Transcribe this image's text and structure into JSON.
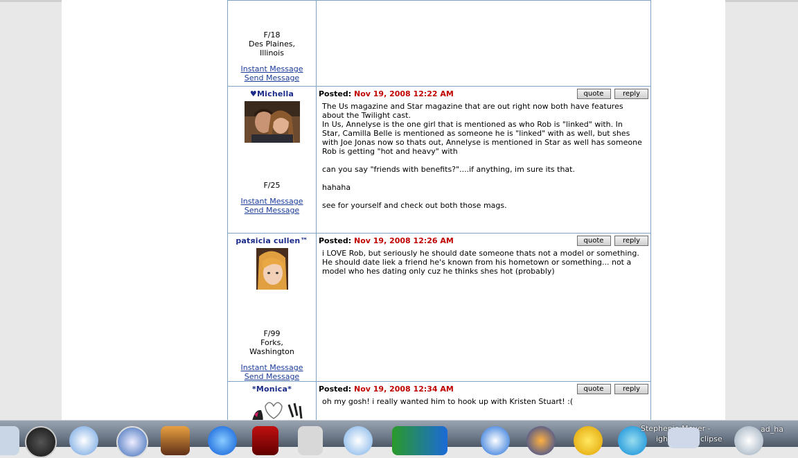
{
  "posts": [
    {
      "username": "",
      "has_avatar": false,
      "meta": [
        "F/18",
        "Des Plaines,",
        "Illinois"
      ],
      "links": [
        "Instant Message",
        "Send Message"
      ],
      "posted_label": "",
      "date": "",
      "buttons": [],
      "body": ""
    },
    {
      "username": "♥Michella",
      "has_avatar": true,
      "meta": [
        "F/25"
      ],
      "links": [
        "Instant Message",
        "Send Message"
      ],
      "posted_label": "Posted:",
      "date": "Nov 19, 2008 12:22 AM",
      "buttons": [
        "quote",
        "reply"
      ],
      "body": "The Us magazine and Star magazine that are out right now both have features about the Twilight cast.\nIn Us, Annelyse is the one girl that is mentioned as who Rob is \"linked\" with. In Star, Camilla Belle is mentioned as someone he is \"linked\" with as well, but shes with Joe Jonas now so thats out, Annelyse is mentioned in Star as well has someone Rob is getting \"hot and heavy\" with\n\ncan you say \"friends with benefits?\"....if anything, im sure its that.\n\nhahaha\n\nsee for yourself and check out both those mags."
    },
    {
      "username": "patяicia cullen™",
      "has_avatar": true,
      "meta": [
        "F/99",
        "Forks,",
        "Washington"
      ],
      "links": [
        "Instant Message",
        "Send Message"
      ],
      "posted_label": "Posted:",
      "date": "Nov 19, 2008 12:26 AM",
      "buttons": [
        "quote",
        "reply"
      ],
      "body": "i LOVE Rob, but seriously he should date someone thats not a model or something. He should date liek a friend he's known from his hometown or something... not a model who hes dating only cuz he thinks shes hot (probably)"
    },
    {
      "username": "*Monica*",
      "has_avatar": true,
      "meta": [],
      "links": [],
      "posted_label": "Posted:",
      "date": "Nov 19, 2008 12:34 AM",
      "buttons": [
        "quote",
        "reply"
      ],
      "body": "oh my gosh! i really wanted him to hook up with Kristen Stuart! :("
    }
  ],
  "dock": {
    "labels": [
      "Stephenie Meyer -",
      "ight",
      "clipse",
      "ad_ha"
    ]
  }
}
